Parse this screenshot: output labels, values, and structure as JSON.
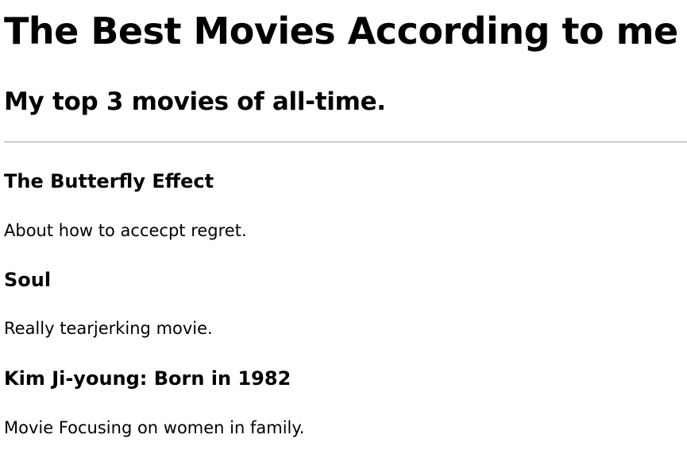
{
  "header": {
    "title": "The Best Movies According to me",
    "subtitle": "My top 3 movies of all-time."
  },
  "movies": [
    {
      "title": "The Butterfly Effect",
      "description": "About how to accecpt regret."
    },
    {
      "title": "Soul",
      "description": "Really tearjerking movie."
    },
    {
      "title": "Kim Ji-young: Born in 1982",
      "description": "Movie Focusing on women in family."
    }
  ]
}
